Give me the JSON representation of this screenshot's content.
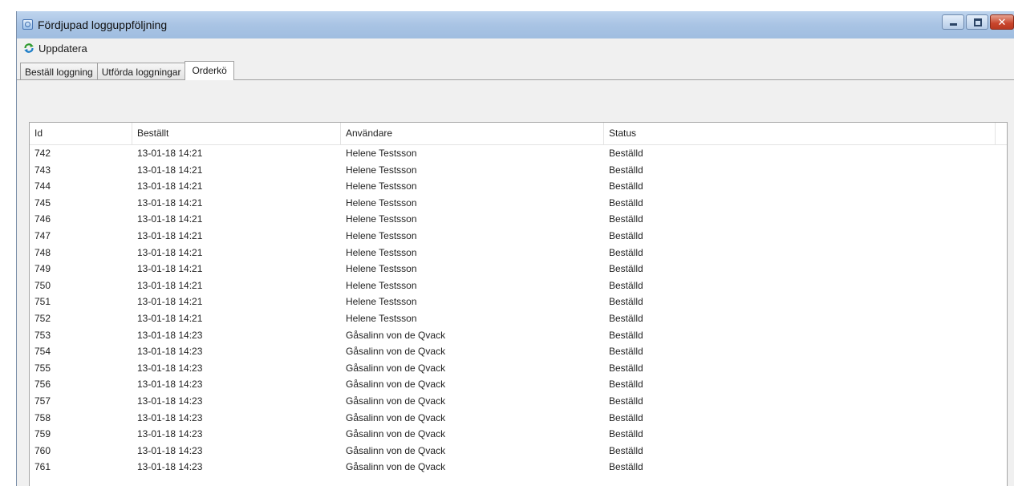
{
  "window": {
    "title": "Fördjupad logguppföljning",
    "icon": "app-icon",
    "controls": [
      "minimize-icon",
      "maximize-icon",
      "close-icon"
    ]
  },
  "toolbar": {
    "refresh_label": "Uppdatera",
    "refresh_icon": "refresh-icon"
  },
  "tabs": [
    {
      "label": "Beställ loggning",
      "active": false
    },
    {
      "label": "Utförda loggningar",
      "active": false
    },
    {
      "label": "Orderkö",
      "active": true
    }
  ],
  "table": {
    "columns": [
      "Id",
      "Beställt",
      "Användare",
      "Status"
    ],
    "rows": [
      [
        "742",
        "13-01-18 14:21",
        "Helene Testsson",
        "Beställd"
      ],
      [
        "743",
        "13-01-18 14:21",
        "Helene Testsson",
        "Beställd"
      ],
      [
        "744",
        "13-01-18 14:21",
        "Helene Testsson",
        "Beställd"
      ],
      [
        "745",
        "13-01-18 14:21",
        "Helene Testsson",
        "Beställd"
      ],
      [
        "746",
        "13-01-18 14:21",
        "Helene Testsson",
        "Beställd"
      ],
      [
        "747",
        "13-01-18 14:21",
        "Helene Testsson",
        "Beställd"
      ],
      [
        "748",
        "13-01-18 14:21",
        "Helene Testsson",
        "Beställd"
      ],
      [
        "749",
        "13-01-18 14:21",
        "Helene Testsson",
        "Beställd"
      ],
      [
        "750",
        "13-01-18 14:21",
        "Helene Testsson",
        "Beställd"
      ],
      [
        "751",
        "13-01-18 14:21",
        "Helene Testsson",
        "Beställd"
      ],
      [
        "752",
        "13-01-18 14:21",
        "Helene Testsson",
        "Beställd"
      ],
      [
        "753",
        "13-01-18 14:23",
        "Gåsalinn von de Qvack",
        "Beställd"
      ],
      [
        "754",
        "13-01-18 14:23",
        "Gåsalinn von de Qvack",
        "Beställd"
      ],
      [
        "755",
        "13-01-18 14:23",
        "Gåsalinn von de Qvack",
        "Beställd"
      ],
      [
        "756",
        "13-01-18 14:23",
        "Gåsalinn von de Qvack",
        "Beställd"
      ],
      [
        "757",
        "13-01-18 14:23",
        "Gåsalinn von de Qvack",
        "Beställd"
      ],
      [
        "758",
        "13-01-18 14:23",
        "Gåsalinn von de Qvack",
        "Beställd"
      ],
      [
        "759",
        "13-01-18 14:23",
        "Gåsalinn von de Qvack",
        "Beställd"
      ],
      [
        "760",
        "13-01-18 14:23",
        "Gåsalinn von de Qvack",
        "Beställd"
      ],
      [
        "761",
        "13-01-18 14:23",
        "Gåsalinn von de Qvack",
        "Beställd"
      ]
    ]
  },
  "colors": {
    "titlebar": "#a9c4e4",
    "close_button": "#c8452c",
    "window_bg": "#f0f0f0"
  }
}
